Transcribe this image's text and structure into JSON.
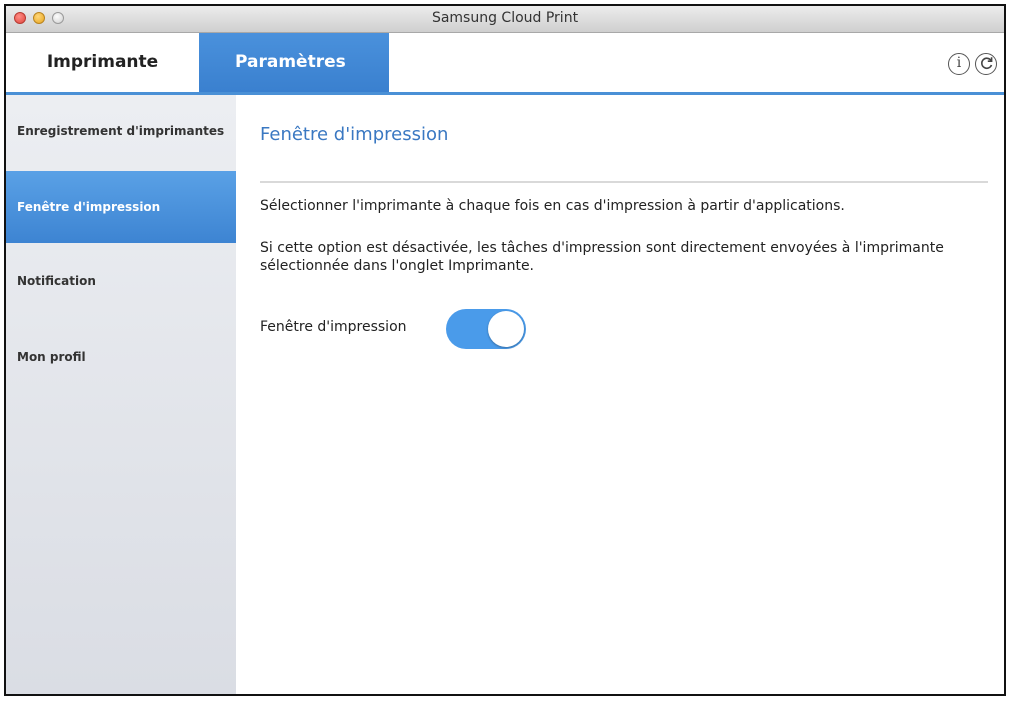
{
  "window": {
    "title": "Samsung Cloud Print"
  },
  "tabs": [
    {
      "label": "Imprimante",
      "active": false
    },
    {
      "label": "Paramètres",
      "active": true
    }
  ],
  "header_icons": [
    "info-icon",
    "refresh-icon"
  ],
  "sidebar": {
    "items": [
      {
        "label": "Enregistrement d'imprimantes",
        "active": false
      },
      {
        "label": "Fenêtre d'impression",
        "active": true
      },
      {
        "label": "Notification",
        "active": false
      },
      {
        "label": "Mon profil",
        "active": false
      }
    ]
  },
  "main": {
    "title": "Fenêtre d'impression",
    "description_1": "Sélectionner l'imprimante à chaque fois en cas d'impression à partir d'applications.",
    "description_2": "Si cette option est désactivée, les tâches d'impression sont directement envoyées à l'imprimante sélectionnée dans l'onglet Imprimante.",
    "toggle": {
      "label": "Fenêtre d'impression",
      "on": true
    }
  },
  "colors": {
    "accent": "#4a90d6",
    "active_tab": "#3a80cf",
    "toggle_on": "#4a9bea",
    "title_text": "#3a78c2"
  }
}
